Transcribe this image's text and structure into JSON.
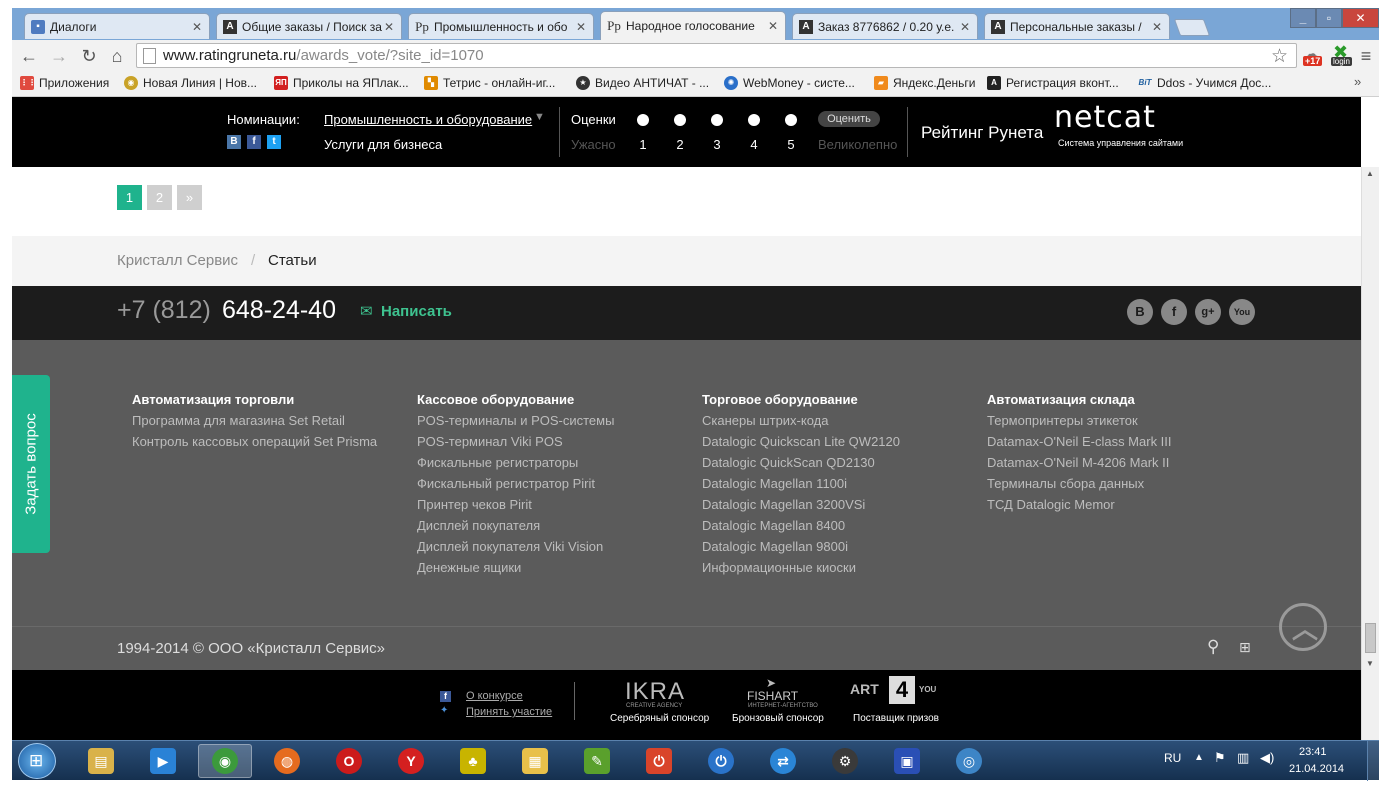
{
  "browser": {
    "tabs": [
      {
        "title": "Диалоги",
        "favicon": "message-icon",
        "active": false
      },
      {
        "title": "Общие заказы / Поиск за",
        "favicon": "a-icon",
        "active": false
      },
      {
        "title": "Промышленность и обо",
        "favicon": "pp-icon",
        "active": false
      },
      {
        "title": "Народное голосование",
        "favicon": "pp-icon",
        "active": true
      },
      {
        "title": "Заказ 8776862 / 0.20 у.е.",
        "favicon": "a-icon",
        "active": false
      },
      {
        "title": "Персональные заказы /",
        "favicon": "a-icon",
        "active": false
      }
    ],
    "url": {
      "host": "www.ratingruneta.ru",
      "path": "/awards_vote/?site_id=1070"
    },
    "bookmarks": [
      {
        "label": "Приложения",
        "icon": "apps-icon",
        "color": "#e04a3f"
      },
      {
        "label": "Новая Линия | Нов...",
        "icon": "bookmark-icon",
        "color": "#c9a227"
      },
      {
        "label": "Приколы на ЯПлак...",
        "icon": "yap-icon",
        "color": "#d21f1f"
      },
      {
        "label": "Тетрис - онлайн-иг...",
        "icon": "tetris-icon",
        "color": "#e08a00"
      },
      {
        "label": "Видео АНТИЧАТ - ...",
        "icon": "antichat-icon",
        "color": "#333333"
      },
      {
        "label": "WebMoney - систе...",
        "icon": "webmoney-icon",
        "color": "#2a6fc9"
      },
      {
        "label": "Яндекс.Деньги",
        "icon": "yandex-money-icon",
        "color": "#f08a1c"
      },
      {
        "label": "Регистрация вконт...",
        "icon": "a-icon",
        "color": "#222222"
      },
      {
        "label": "Ddos - Учимся Дос...",
        "icon": "bit-icon",
        "color": "#2060a0"
      }
    ],
    "ext_badge": "+17",
    "ext_login": "login"
  },
  "rating": {
    "nominations_label": "Номинации:",
    "nomination_selected": "Промышленность и оборудование",
    "nomination_second": "Услуги для бизнеса",
    "scores_label": "Оценки",
    "worst_label": "Ужасно",
    "best_label": "Великолепно",
    "scores": [
      "1",
      "2",
      "3",
      "4",
      "5"
    ],
    "rate_button": "Оценить",
    "brand": "Рейтинг Рунета",
    "netcat_logo": "netcat",
    "netcat_tagline": "Система управления сайтами"
  },
  "pagination": {
    "pages": [
      "1",
      "2"
    ],
    "next": "»",
    "current": "1"
  },
  "breadcrumb": {
    "parent": "Кристалл Сервис",
    "separator": "/",
    "current": "Статьи"
  },
  "contact": {
    "phone_prefix": "+7 (812)",
    "phone_number": "648-24-40",
    "write": "Написать"
  },
  "social": [
    {
      "name": "vk-icon",
      "glyph": "B"
    },
    {
      "name": "facebook-icon",
      "glyph": "f"
    },
    {
      "name": "google-plus-icon",
      "glyph": "g+"
    },
    {
      "name": "youtube-icon",
      "glyph": "You"
    }
  ],
  "footer_columns": [
    {
      "heading": "Автоматизация торговли",
      "items": [
        "Программа для магазина Set Retail",
        "Контроль кассовых операций Set Prisma"
      ]
    },
    {
      "heading": "Кассовое оборудование",
      "items": [
        "POS-терминалы и POS-системы",
        "POS-терминал Viki POS",
        "Фискальные регистраторы",
        "Фискальный регистратор Pirit",
        "Принтер чеков Pirit",
        "Дисплей покупателя",
        "Дисплей покупателя Viki Vision",
        "Денежные ящики"
      ]
    },
    {
      "heading": "Торговое оборудование",
      "items": [
        "Сканеры штрих-кода",
        "Datalogic Quickscan Lite QW2120",
        "Datalogic QuickScan QD2130",
        "Datalogic Magellan 1100i",
        "Datalogic Magellan 3200VSi",
        "Datalogic Magellan 8400",
        "Datalogic Magellan 9800i",
        "Информационные киоски"
      ]
    },
    {
      "heading": "Автоматизация склада",
      "items": [
        "Термопринтеры этикеток",
        "Datamax-O'Neil E-class Mark III",
        "Datamax-O'Neil M-4206 Mark II",
        "Терминалы сбора данных",
        "ТСД Datalogic Memor"
      ]
    }
  ],
  "ask_question": "Задать вопрос",
  "copyright": "1994-2014 © ООО «Кристалл Сервис»",
  "sponsors": {
    "about": "О конкурсе",
    "participate": "Принять участие",
    "items": [
      {
        "logo": "IKRA",
        "logo_sub": "CREATIVE AGENCY",
        "caption": "Серебряный спонсор"
      },
      {
        "logo": "FISHART",
        "logo_sub": "ИНТЕРНЕТ-АГЕНТСТВО",
        "caption": "Бронзовый спонсор"
      },
      {
        "logo": "ART",
        "logo_mid": "4",
        "logo_end": "YOU",
        "caption": "Поставщик призов"
      }
    ]
  },
  "taskbar": {
    "apps": [
      {
        "name": "explorer-icon",
        "color": "#d9b24a"
      },
      {
        "name": "media-player-icon",
        "color": "#2a82d6"
      },
      {
        "name": "chrome-icon",
        "color": "#3c9a3c"
      },
      {
        "name": "firefox-icon",
        "color": "#e56b1f"
      },
      {
        "name": "opera-icon",
        "color": "#cc1b1b"
      },
      {
        "name": "yandex-browser-icon",
        "color": "#d42020"
      },
      {
        "name": "rip-icon",
        "color": "#c8b400"
      },
      {
        "name": "slide-icon",
        "color": "#e8c04a"
      },
      {
        "name": "notepad-icon",
        "color": "#5aa02c"
      },
      {
        "name": "power-app-icon",
        "color": "#d9442a"
      },
      {
        "name": "power-blue-icon",
        "color": "#2a73c9"
      },
      {
        "name": "sync-icon",
        "color": "#2a85d6"
      },
      {
        "name": "steam-icon",
        "color": "#3a3a3a"
      },
      {
        "name": "save-icon",
        "color": "#2a4fb5"
      },
      {
        "name": "globe-icon",
        "color": "#3d85c6"
      }
    ],
    "lang": "RU",
    "time": "23:41",
    "date": "21.04.2014"
  }
}
